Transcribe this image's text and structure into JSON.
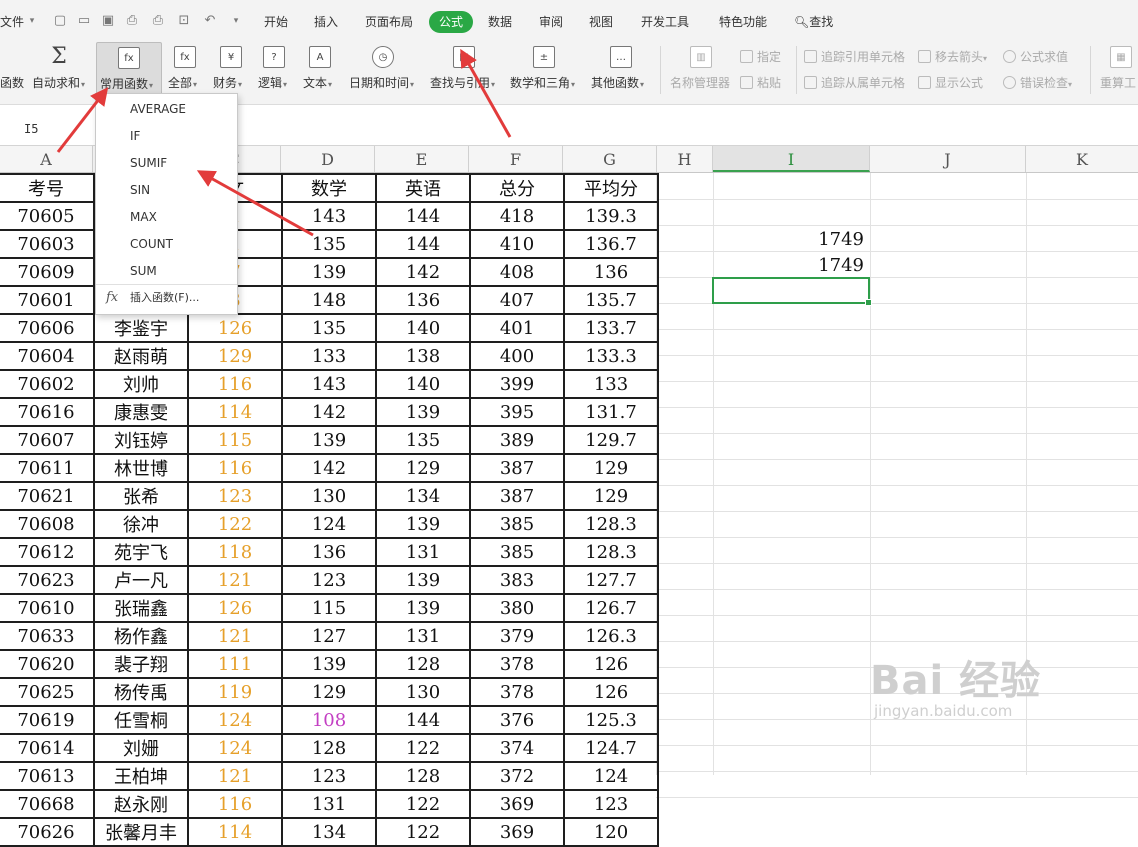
{
  "menu": {
    "file": "文件",
    "tabs": [
      "开始",
      "插入",
      "页面布局",
      "公式",
      "数据",
      "审阅",
      "视图",
      "开发工具",
      "特色功能"
    ],
    "active_tab": "公式",
    "search": "查找"
  },
  "ribbon": {
    "partial_left": "函数",
    "buttons": [
      "自动求和",
      "常用函数",
      "全部",
      "财务",
      "逻辑",
      "文本",
      "日期和时间",
      "查找与引用",
      "数学和三角",
      "其他函数",
      "名称管理器"
    ],
    "paste_label": "粘贴",
    "assign_label": "指定",
    "trace_precedents": "追踪引用单元格",
    "trace_dependents": "追踪从属单元格",
    "remove_arrows": "移去箭头",
    "show_formula": "显示公式",
    "formula_eval": "公式求值",
    "error_check": "错误检查",
    "recalc": "重算工"
  },
  "name_box": "I5",
  "columns": [
    "A",
    "B",
    "C",
    "D",
    "E",
    "F",
    "G",
    "H",
    "I",
    "J",
    "K"
  ],
  "headers": [
    "考号",
    "",
    "文",
    "数学",
    "英语",
    "总分",
    "平均分"
  ],
  "rows": [
    [
      "70605",
      "",
      "1",
      "143",
      "144",
      "418",
      "139.3"
    ],
    [
      "70603",
      "",
      "1",
      "135",
      "144",
      "410",
      "136.7"
    ],
    [
      "70609",
      "",
      "7",
      "139",
      "142",
      "408",
      "136"
    ],
    [
      "70601",
      "",
      "3",
      "148",
      "136",
      "407",
      "135.7"
    ],
    [
      "70606",
      "李鉴宇",
      "126",
      "135",
      "140",
      "401",
      "133.7"
    ],
    [
      "70604",
      "赵雨萌",
      "129",
      "133",
      "138",
      "400",
      "133.3"
    ],
    [
      "70602",
      "刘帅",
      "116",
      "143",
      "140",
      "399",
      "133"
    ],
    [
      "70616",
      "康惠雯",
      "114",
      "142",
      "139",
      "395",
      "131.7"
    ],
    [
      "70607",
      "刘钰婷",
      "115",
      "139",
      "135",
      "389",
      "129.7"
    ],
    [
      "70611",
      "林世博",
      "116",
      "142",
      "129",
      "387",
      "129"
    ],
    [
      "70621",
      "张希",
      "123",
      "130",
      "134",
      "387",
      "129"
    ],
    [
      "70608",
      "徐冲",
      "122",
      "124",
      "139",
      "385",
      "128.3"
    ],
    [
      "70612",
      "苑宇飞",
      "118",
      "136",
      "131",
      "385",
      "128.3"
    ],
    [
      "70623",
      "卢一凡",
      "121",
      "123",
      "139",
      "383",
      "127.7"
    ],
    [
      "70610",
      "张瑞鑫",
      "126",
      "115",
      "139",
      "380",
      "126.7"
    ],
    [
      "70633",
      "杨作鑫",
      "121",
      "127",
      "131",
      "379",
      "126.3"
    ],
    [
      "70620",
      "裴子翔",
      "111",
      "139",
      "128",
      "378",
      "126"
    ],
    [
      "70625",
      "杨传禹",
      "119",
      "129",
      "130",
      "378",
      "126"
    ],
    [
      "70619",
      "任雪桐",
      "124",
      "108",
      "144",
      "376",
      "125.3"
    ],
    [
      "70614",
      "刘姗",
      "124",
      "128",
      "122",
      "374",
      "124.7"
    ],
    [
      "70613",
      "王柏坤",
      "121",
      "123",
      "128",
      "372",
      "124"
    ],
    [
      "70668",
      "赵永刚",
      "116",
      "131",
      "122",
      "369",
      "123"
    ],
    [
      "70626",
      "张馨月丰",
      "114",
      "134",
      "122",
      "369",
      "120"
    ]
  ],
  "column_I_values": [
    "1749",
    "1749"
  ],
  "dropdown": {
    "items": [
      "AVERAGE",
      "IF",
      "SUMIF",
      "SIN",
      "MAX",
      "COUNT",
      "SUM"
    ],
    "fx": "fx",
    "insert_function": "插入函数(F)..."
  },
  "watermark": {
    "brand": "Bai 经验",
    "url": "jingyan.baidu.com"
  },
  "colors": {
    "accent_green": "#2aa845",
    "chinese_score": "#e6a02a",
    "low_score": "#c33fc3",
    "arrow_red": "#e23b3b"
  }
}
